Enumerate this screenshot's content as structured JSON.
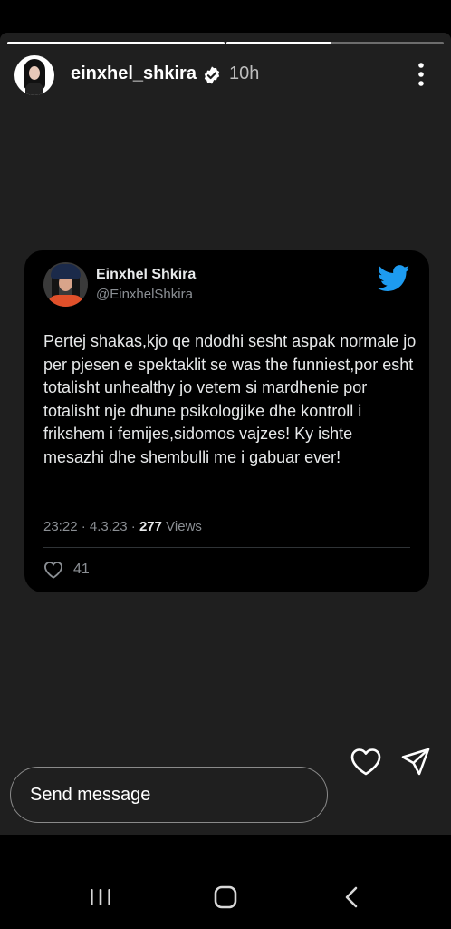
{
  "story": {
    "progress": [
      1.0,
      0.48
    ],
    "username": "einxhel_shkira",
    "time": "10h"
  },
  "tweet": {
    "name": "Einxhel Shkira",
    "handle": "@EinxhelShkira",
    "text": "Pertej shakas,kjo qe ndodhi sesht aspak normale jo per pjesen e spektaklit se was the funniest,por esht totalisht unhealthy jo vetem si mardhenie por totalisht nje dhune psikologjike dhe kontroll i frikshem i femijes,sidomos vajzes! Ky ishte mesazhi dhe shembulli me i gabuar ever!",
    "time": "23:22",
    "date": "4.3.23",
    "views_count": "277",
    "views_label": "Views",
    "likes": "41"
  },
  "reply": {
    "placeholder": "Send message"
  },
  "colors": {
    "story_bg": "#1f1f1f",
    "tweet_bg": "#000000",
    "twitter_blue": "#1d9bf0",
    "verified_bg": "#ffffff"
  },
  "icons": {
    "verified": "verified-badge-icon",
    "more": "more-vertical-icon",
    "twitter": "twitter-bird-icon",
    "like": "heart-outline-icon",
    "share": "paper-plane-icon",
    "nav_recent": "recent-apps-icon",
    "nav_home": "home-icon",
    "nav_back": "back-chevron-icon"
  }
}
